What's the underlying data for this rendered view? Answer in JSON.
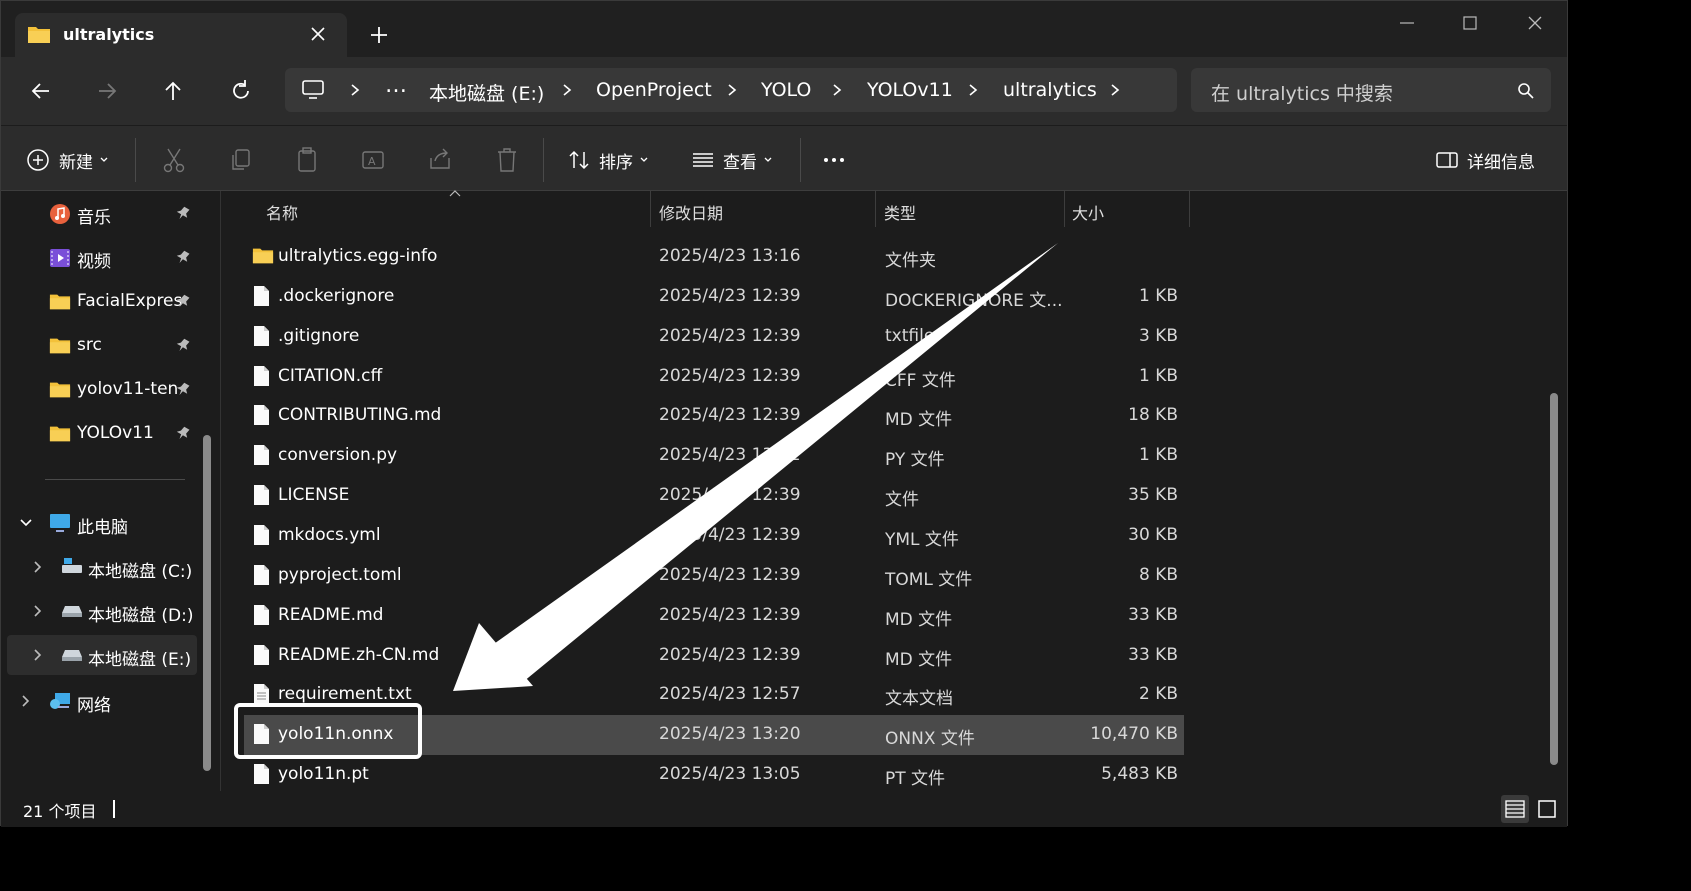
{
  "tab": {
    "title": "ultralytics"
  },
  "breadcrumb": [
    "本地磁盘 (E:)",
    "OpenProject",
    "YOLO",
    "YOLOv11",
    "ultralytics"
  ],
  "breadcrumb_more": "…",
  "search": {
    "placeholder": "在 ultralytics 中搜索"
  },
  "toolbar": {
    "new_label": "新建",
    "sort_label": "排序",
    "view_label": "查看",
    "more_label": "…",
    "details_label": "详细信息"
  },
  "sidebar": {
    "quick_access": [
      {
        "label": "音乐",
        "icon": "music-icon",
        "pinned": true
      },
      {
        "label": "视频",
        "icon": "video-icon",
        "pinned": true
      },
      {
        "label": "FacialExpres",
        "icon": "folder-icon",
        "pinned": true
      },
      {
        "label": "src",
        "icon": "folder-icon",
        "pinned": true
      },
      {
        "label": "yolov11-ten",
        "icon": "folder-icon",
        "pinned": true
      },
      {
        "label": "YOLOv11",
        "icon": "folder-icon",
        "pinned": true
      }
    ],
    "this_pc": "此电脑",
    "drives": [
      "本地磁盘 (C:)",
      "本地磁盘 (D:)",
      "本地磁盘 (E:)"
    ],
    "network": "网络"
  },
  "columns": {
    "name": "名称",
    "date": "修改日期",
    "type": "类型",
    "size": "大小"
  },
  "files": [
    {
      "name": "ultralytics.egg-info",
      "date": "2025/4/23 13:16",
      "type": "文件夹",
      "size": "",
      "icon": "folder-icon"
    },
    {
      "name": ".dockerignore",
      "date": "2025/4/23 12:39",
      "type": "DOCKERIGNORE 文...",
      "size": "1 KB",
      "icon": "file-icon"
    },
    {
      "name": ".gitignore",
      "date": "2025/4/23 12:39",
      "type": "txtfile",
      "size": "3 KB",
      "icon": "file-icon"
    },
    {
      "name": "CITATION.cff",
      "date": "2025/4/23 12:39",
      "type": "CFF 文件",
      "size": "1 KB",
      "icon": "file-icon"
    },
    {
      "name": "CONTRIBUTING.md",
      "date": "2025/4/23 12:39",
      "type": "MD 文件",
      "size": "18 KB",
      "icon": "file-icon"
    },
    {
      "name": "conversion.py",
      "date": "2025/4/23 13:02",
      "type": "PY 文件",
      "size": "1 KB",
      "icon": "file-icon"
    },
    {
      "name": "LICENSE",
      "date": "2025/4/23 12:39",
      "type": "文件",
      "size": "35 KB",
      "icon": "file-icon"
    },
    {
      "name": "mkdocs.yml",
      "date": "2025/4/23 12:39",
      "type": "YML 文件",
      "size": "30 KB",
      "icon": "file-icon"
    },
    {
      "name": "pyproject.toml",
      "date": "2025/4/23 12:39",
      "type": "TOML 文件",
      "size": "8 KB",
      "icon": "file-icon"
    },
    {
      "name": "README.md",
      "date": "2025/4/23 12:39",
      "type": "MD 文件",
      "size": "33 KB",
      "icon": "file-icon"
    },
    {
      "name": "README.zh-CN.md",
      "date": "2025/4/23 12:39",
      "type": "MD 文件",
      "size": "33 KB",
      "icon": "file-icon"
    },
    {
      "name": "requirement.txt",
      "date": "2025/4/23 12:57",
      "type": "文本文档",
      "size": "2 KB",
      "icon": "text-file-icon"
    },
    {
      "name": "yolo11n.onnx",
      "date": "2025/4/23 13:20",
      "type": "ONNX 文件",
      "size": "10,470 KB",
      "icon": "file-icon",
      "selected": true
    },
    {
      "name": "yolo11n.pt",
      "date": "2025/4/23 13:05",
      "type": "PT 文件",
      "size": "5,483 KB",
      "icon": "file-icon"
    }
  ],
  "status": {
    "count": "21 个项目"
  },
  "colors": {
    "background": "#1c1c1c",
    "toolbar": "#2c2c2c",
    "selected_row": "#4a4a4a",
    "folder": "#f3c13a",
    "annotation": "#ffffff"
  }
}
